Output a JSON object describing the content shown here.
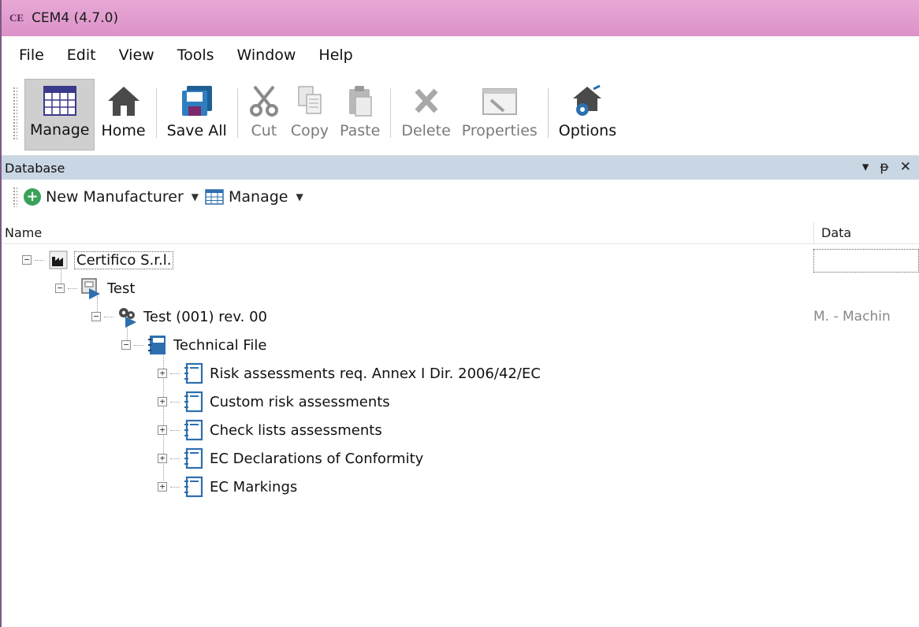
{
  "window": {
    "app_icon": "CE",
    "title": "CEM4 (4.7.0)"
  },
  "menubar": [
    "File",
    "Edit",
    "View",
    "Tools",
    "Window",
    "Help"
  ],
  "toolbar": {
    "manage": "Manage",
    "home": "Home",
    "save_all": "Save All",
    "cut": "Cut",
    "copy": "Copy",
    "paste": "Paste",
    "delete": "Delete",
    "properties": "Properties",
    "options": "Options"
  },
  "panel": {
    "title": "Database",
    "ctrl_dropdown": "▾",
    "ctrl_pin": "ᵽ",
    "ctrl_close": "✕",
    "new_manufacturer": "New Manufacturer",
    "manage": "Manage",
    "plus": "+"
  },
  "columns": {
    "name": "Name",
    "data": "Data"
  },
  "tree": {
    "root": "Certifico S.r.l.",
    "test": "Test",
    "machine": "Test (001) rev. 00",
    "machine_data": "M. - Machin",
    "technical_file": "Technical File",
    "children": [
      "Risk assessments req. Annex I Dir. 2006/42/EC",
      "Custom risk assessments",
      "Check lists assessments",
      "EC Declarations of Conformity",
      "EC Markings"
    ],
    "expander_collapse": "−",
    "expander_expand": "+"
  },
  "colors": {
    "titlebar": "#e0a0d0",
    "panel_header": "#c9d6e4",
    "accent_blue": "#2e6fae",
    "green": "#3aa15a"
  }
}
